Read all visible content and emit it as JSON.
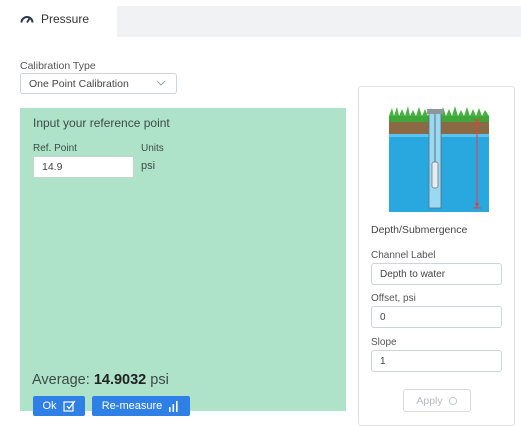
{
  "tabs": [
    {
      "label": "Pressure",
      "icon": "gauge-icon",
      "active": true
    }
  ],
  "calibration": {
    "label": "Calibration Type",
    "selected": "One Point Calibration"
  },
  "reference": {
    "title": "Input your reference point",
    "ref_label": "Ref. Point",
    "ref_value": "14.9",
    "units_label": "Units",
    "units_value": "psi",
    "average_label": "Average:",
    "average_value": "14.9032",
    "average_unit": "psi",
    "ok_label": "Ok",
    "remeasure_label": "Re-measure"
  },
  "sensor_panel": {
    "heading": "Depth/Submergence",
    "channel_label": "Channel Label",
    "channel_value": "Depth to water",
    "offset_label": "Offset, psi",
    "offset_value": "0",
    "slope_label": "Slope",
    "slope_value": "1",
    "apply_label": "Apply"
  },
  "colors": {
    "accent": "#2f80e6",
    "panel_green": "#aee3ca",
    "water": "#29a8e0",
    "measure_line": "#e04040"
  }
}
